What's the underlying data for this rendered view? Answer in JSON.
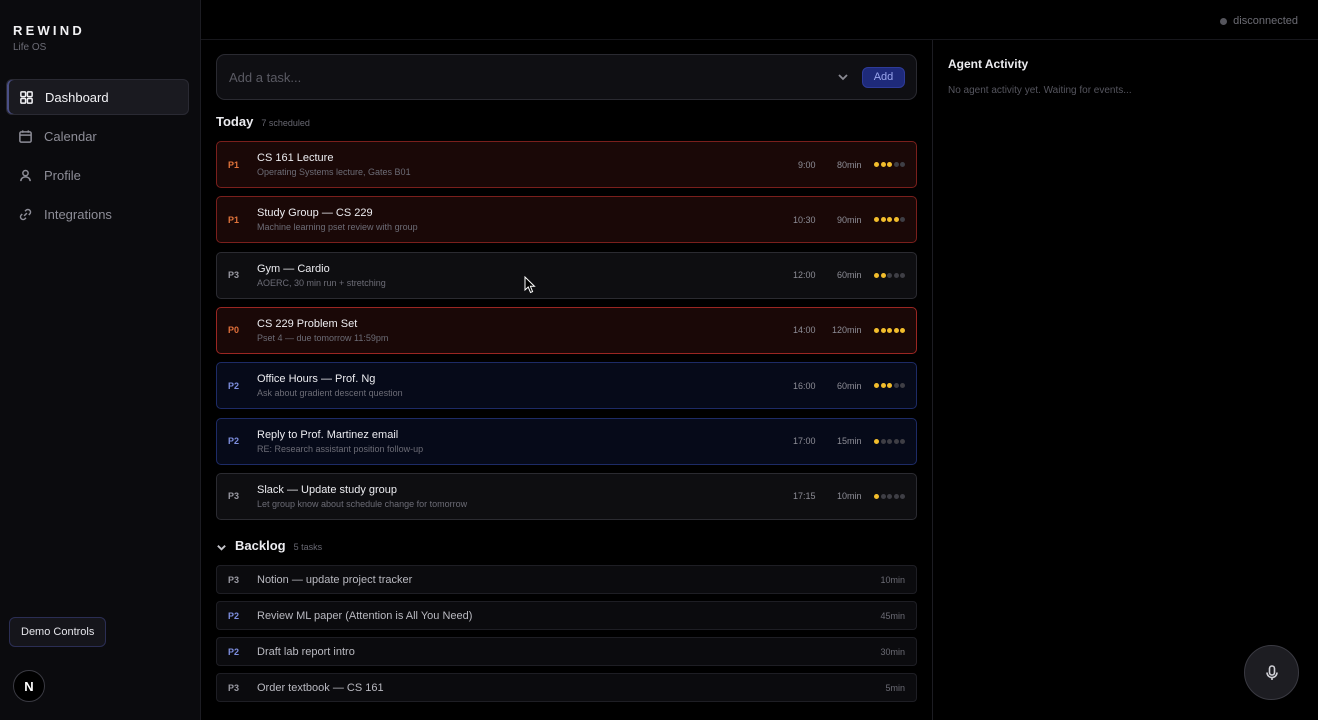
{
  "brand": {
    "title": "REWIND",
    "subtitle": "Life OS"
  },
  "nav": [
    {
      "label": "Dashboard",
      "icon": "grid-icon",
      "active": true
    },
    {
      "label": "Calendar",
      "icon": "calendar-icon",
      "active": false
    },
    {
      "label": "Profile",
      "icon": "user-icon",
      "active": false
    },
    {
      "label": "Integrations",
      "icon": "link-icon",
      "active": false
    }
  ],
  "demo_controls_label": "Demo Controls",
  "avatar_letter": "N",
  "connection_status": "disconnected",
  "task_input": {
    "placeholder": "Add a task...",
    "add_label": "Add"
  },
  "today": {
    "title": "Today",
    "count": "7 scheduled",
    "tasks": [
      {
        "priority": "P1",
        "title": "CS 161 Lecture",
        "desc": "Operating Systems lecture, Gates B01",
        "time": "9:00",
        "duration": "80min",
        "energy": 3
      },
      {
        "priority": "P1",
        "title": "Study Group — CS 229",
        "desc": "Machine learning pset review with group",
        "time": "10:30",
        "duration": "90min",
        "energy": 4
      },
      {
        "priority": "P3",
        "title": "Gym — Cardio",
        "desc": "AOERC, 30 min run + stretching",
        "time": "12:00",
        "duration": "60min",
        "energy": 2
      },
      {
        "priority": "P0",
        "title": "CS 229 Problem Set",
        "desc": "Pset 4 — due tomorrow 11:59pm",
        "time": "14:00",
        "duration": "120min",
        "energy": 5
      },
      {
        "priority": "P2",
        "title": "Office Hours — Prof. Ng",
        "desc": "Ask about gradient descent question",
        "time": "16:00",
        "duration": "60min",
        "energy": 3
      },
      {
        "priority": "P2",
        "title": "Reply to Prof. Martinez email",
        "desc": "RE: Research assistant position follow-up",
        "time": "17:00",
        "duration": "15min",
        "energy": 1
      },
      {
        "priority": "P3",
        "title": "Slack — Update study group",
        "desc": "Let group know about schedule change for tomorrow",
        "time": "17:15",
        "duration": "10min",
        "energy": 1
      }
    ]
  },
  "backlog": {
    "title": "Backlog",
    "count": "5 tasks",
    "tasks": [
      {
        "priority": "P3",
        "title": "Notion — update project tracker",
        "duration": "10min"
      },
      {
        "priority": "P2",
        "title": "Review ML paper (Attention is All You Need)",
        "duration": "45min"
      },
      {
        "priority": "P2",
        "title": "Draft lab report intro",
        "duration": "30min"
      },
      {
        "priority": "P3",
        "title": "Order textbook — CS 161",
        "duration": "5min"
      }
    ]
  },
  "agent": {
    "title": "Agent Activity",
    "empty_text": "No agent activity yet. Waiting for events..."
  },
  "colors": {
    "accent": "#1e2a7a",
    "energy_on": "#f2bd2c",
    "p1_border": "#7a1f1c",
    "p2_border": "#1d2b66"
  }
}
